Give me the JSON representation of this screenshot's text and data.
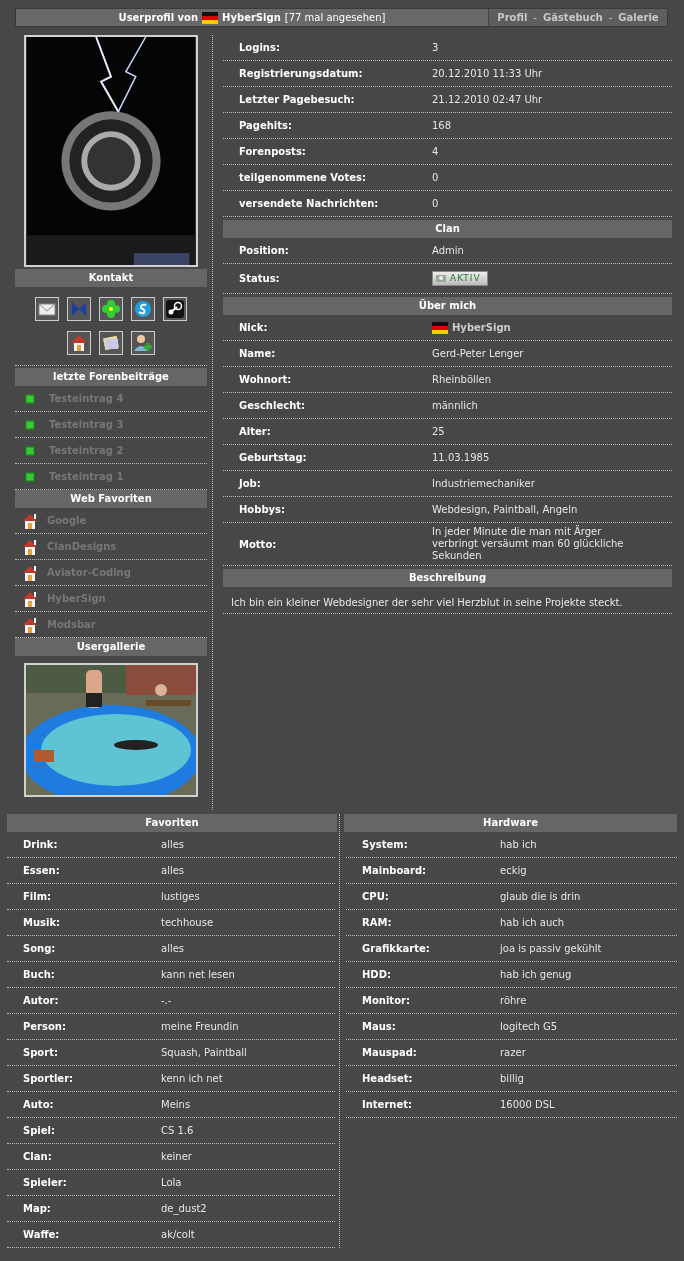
{
  "header": {
    "title_prefix": "Userprofil von",
    "user": "HyberSign",
    "views": "[77 mal angesehen]",
    "nav_separator": "-",
    "nav": [
      {
        "label": "Profil"
      },
      {
        "label": "Gästebuch"
      },
      {
        "label": "Galerie"
      }
    ]
  },
  "sidebar": {
    "contact_title": "Kontakt",
    "posts_title": "letzte Forenbeiträge",
    "posts": [
      {
        "label": "Testeintrag 4"
      },
      {
        "label": "Testeintrag 3"
      },
      {
        "label": "Testeintrag 2"
      },
      {
        "label": "Testeintrag 1"
      }
    ],
    "links_title": "Web Favoriten",
    "links": [
      {
        "label": "Google"
      },
      {
        "label": "ClanDesigns"
      },
      {
        "label": "Aviator-Coding"
      },
      {
        "label": "HyberSign"
      },
      {
        "label": "Modsbar"
      }
    ],
    "gallery_title": "Usergallerie"
  },
  "stats": [
    {
      "label": "Logins:",
      "value": "3"
    },
    {
      "label": "Registrierungsdatum:",
      "value": "20.12.2010 11:33 Uhr"
    },
    {
      "label": "Letzter Pagebesuch:",
      "value": "21.12.2010 02:47 Uhr"
    },
    {
      "label": "Pagehits:",
      "value": "168"
    },
    {
      "label": "Forenposts:",
      "value": "4"
    },
    {
      "label": "teilgenommene Votes:",
      "value": "0"
    },
    {
      "label": "versendete Nachrichten:",
      "value": "0"
    }
  ],
  "sections": [
    {
      "title": "Clan",
      "rows": [
        {
          "kind": "text",
          "label": "Position:",
          "value": "Admin"
        },
        {
          "kind": "badge",
          "label": "Status:",
          "value": "AKTIV"
        }
      ]
    },
    {
      "title": "Über mich",
      "rows": [
        {
          "kind": "flag",
          "label": "Nick:",
          "value": "HyberSign"
        },
        {
          "kind": "text",
          "label": "Name:",
          "value": "Gerd-Peter Lenger"
        },
        {
          "kind": "text",
          "label": "Wohnort:",
          "value": "Rheinböllen"
        },
        {
          "kind": "text",
          "label": "Geschlecht:",
          "value": "männlich"
        },
        {
          "kind": "text",
          "label": "Alter:",
          "value": "25"
        },
        {
          "kind": "text",
          "label": "Geburtstag:",
          "value": "11.03.1985"
        },
        {
          "kind": "text",
          "label": "Job:",
          "value": "Industriemechaniker"
        },
        {
          "kind": "text",
          "label": "Hobbys:",
          "value": "Webdesign, Paintball, Angeln"
        },
        {
          "kind": "text",
          "label": "Motto:",
          "value": "In jeder Minute die man mit Ärger verbringt versäumt man 60 glückliche Sekunden"
        }
      ]
    }
  ],
  "description": {
    "title": "Beschreibung",
    "text": "Ich bin ein kleiner Webdesigner der sehr viel Herzblut in seine Projekte steckt."
  },
  "favorites": {
    "title": "Favoriten",
    "rows": [
      {
        "label": "Drink:",
        "value": "alles"
      },
      {
        "label": "Essen:",
        "value": "alles"
      },
      {
        "label": "Film:",
        "value": "lustiges"
      },
      {
        "label": "Musik:",
        "value": "techhouse"
      },
      {
        "label": "Song:",
        "value": "alles"
      },
      {
        "label": "Buch:",
        "value": "kann net lesen"
      },
      {
        "label": "Autor:",
        "value": "-.-"
      },
      {
        "label": "Person:",
        "value": "meine Freundin"
      },
      {
        "label": "Sport:",
        "value": "Squash, Paintball"
      },
      {
        "label": "Sportler:",
        "value": "kenn ich net"
      },
      {
        "label": "Auto:",
        "value": "Meins"
      },
      {
        "label": "Spiel:",
        "value": "CS 1.6"
      },
      {
        "label": "Clan:",
        "value": "keiner"
      },
      {
        "label": "Spieler:",
        "value": "Lola"
      },
      {
        "label": "Map:",
        "value": "de_dust2"
      },
      {
        "label": "Waffe:",
        "value": "ak/colt"
      }
    ]
  },
  "hardware": {
    "title": "Hardware",
    "rows": [
      {
        "label": "System:",
        "value": "hab ich"
      },
      {
        "label": "Mainboard:",
        "value": "eckig"
      },
      {
        "label": "CPU:",
        "value": "glaub die is drin"
      },
      {
        "label": "RAM:",
        "value": "hab ich auch"
      },
      {
        "label": "Grafikkarte:",
        "value": "joa is passiv gekühlt"
      },
      {
        "label": "HDD:",
        "value": "hab ich genug"
      },
      {
        "label": "Monitor:",
        "value": "röhre"
      },
      {
        "label": "Maus:",
        "value": "logitech G5"
      },
      {
        "label": "Mauspad:",
        "value": "razer"
      },
      {
        "label": "Headset:",
        "value": "billig"
      },
      {
        "label": "Internet:",
        "value": "16000 DSL"
      }
    ]
  }
}
